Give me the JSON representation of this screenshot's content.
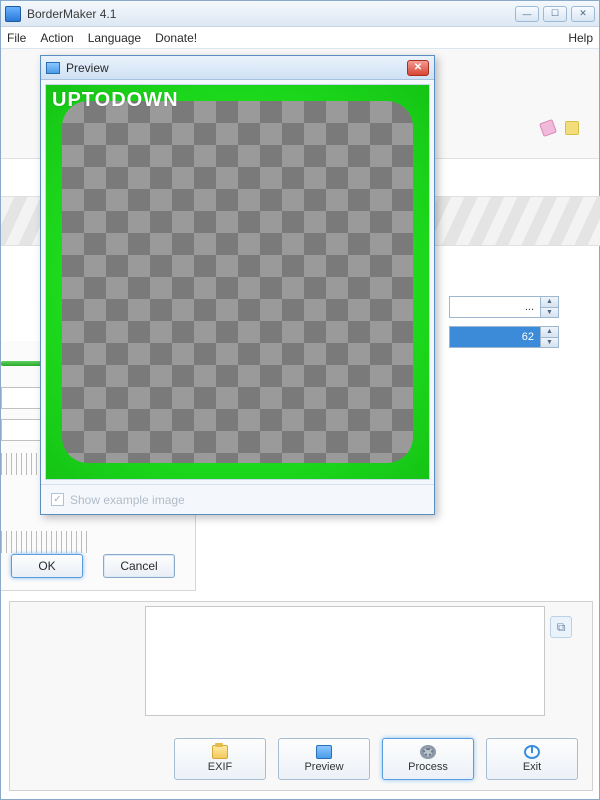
{
  "app": {
    "title": "BorderMaker 4.1"
  },
  "menu": {
    "file": "File",
    "action": "Action",
    "language": "Language",
    "donate": "Donate!",
    "help": "Help"
  },
  "window_controls": {
    "minimize": "—",
    "maximize": "☐",
    "close": "✕"
  },
  "right_inputs": {
    "item0": "...",
    "item1": "62"
  },
  "left_dialog": {
    "ok": "OK",
    "cancel": "Cancel"
  },
  "bottom_buttons": {
    "exif": "EXIF",
    "preview": "Preview",
    "process": "Process",
    "exit": "Exit"
  },
  "preview": {
    "title": "Preview",
    "watermark": "UPTODOWN",
    "show_example": "Show example image",
    "show_example_checked": true,
    "border_color": "#1ee01e"
  }
}
